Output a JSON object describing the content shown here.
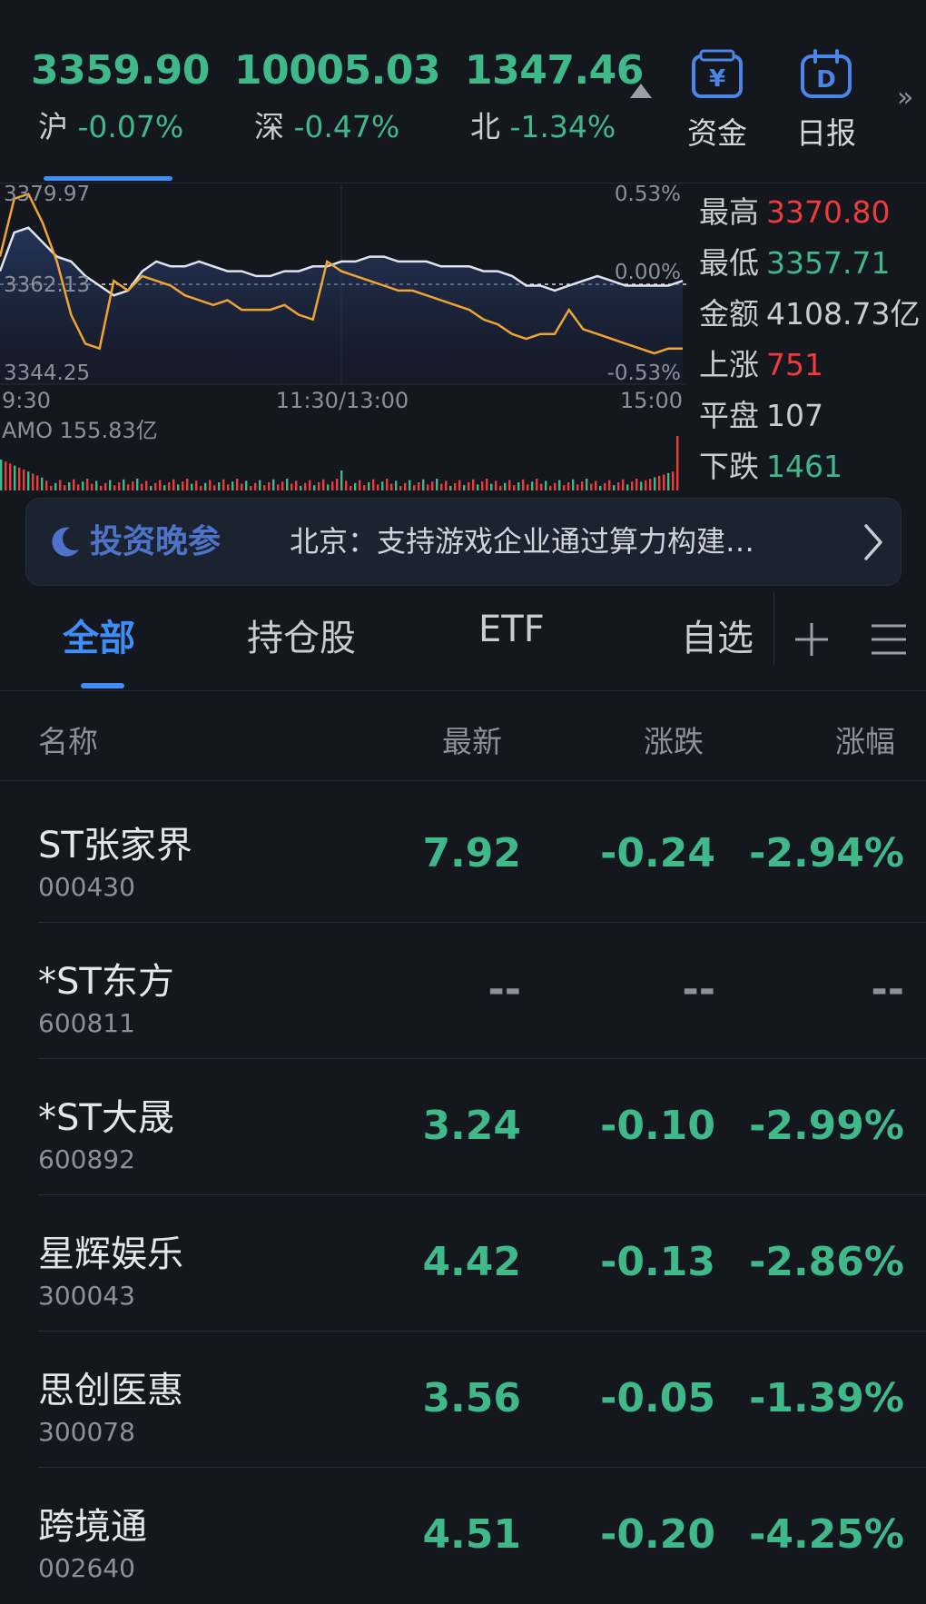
{
  "indices": [
    {
      "value": "3359.90",
      "name": "沪",
      "change": "-0.07%"
    },
    {
      "value": "10005.03",
      "name": "深",
      "change": "-0.47%"
    },
    {
      "value": "1347.46",
      "name": "北",
      "change": "-1.34%"
    }
  ],
  "shortcuts": [
    {
      "label": "资金",
      "icon": "yen-box-icon"
    },
    {
      "label": "日报",
      "icon": "calendar-d-icon"
    }
  ],
  "more_glyph": "»",
  "chart": {
    "y_high": "3379.97",
    "y_mid": "3362.13",
    "y_low": "3344.25",
    "pct_high": "0.53%",
    "pct_mid": "0.00%",
    "pct_low": "-0.53%",
    "time_start": "9:30",
    "time_mid": "11:30/13:00",
    "time_end": "15:00",
    "amo_label": "AMO 155.83亿",
    "colors": {
      "index_line": "#dfe4ee",
      "avg_line": "#f0a531",
      "up": "#ef3b3b",
      "down": "#3fb98a"
    }
  },
  "chart_data": {
    "type": "line",
    "ylim": [
      3344.25,
      3379.97
    ],
    "x_ticks": [
      "9:30",
      "11:30/13:00",
      "15:00"
    ],
    "series": [],
    "x": [
      0,
      1,
      2,
      3,
      4,
      5,
      6,
      7,
      8,
      9,
      10,
      11,
      12,
      13,
      14,
      15,
      16,
      17,
      18,
      19,
      20,
      21,
      22,
      23,
      24,
      25,
      26,
      27,
      28,
      29,
      30,
      31,
      32,
      33,
      34,
      35,
      36,
      37,
      38,
      39,
      40,
      41,
      42,
      43,
      44,
      45,
      46,
      47,
      48
    ],
    "line_a": [
      3362,
      3370,
      3371,
      3368,
      3365,
      3364,
      3361,
      3359,
      3357,
      3358,
      3362,
      3364,
      3363,
      3363,
      3364,
      3363,
      3362,
      3362,
      3361,
      3361,
      3362,
      3362,
      3363,
      3363,
      3364,
      3364,
      3365,
      3365,
      3364,
      3364,
      3364,
      3363,
      3363,
      3363,
      3362,
      3362,
      3361,
      3359,
      3359,
      3358,
      3359,
      3360,
      3361,
      3360,
      3359,
      3359,
      3359,
      3359,
      3360
    ],
    "line_b": [
      3365,
      3377,
      3378,
      3372,
      3364,
      3353,
      3347,
      3346,
      3360,
      3358,
      3361,
      3360,
      3359,
      3357,
      3356,
      3355,
      3356,
      3354,
      3354,
      3354,
      3355,
      3353,
      3352,
      3364,
      3362,
      3361,
      3360,
      3359,
      3358,
      3358,
      3357,
      3356,
      3355,
      3354,
      3352,
      3351,
      3349,
      3348,
      3349,
      3349,
      3354,
      3350,
      3349,
      3348,
      3347,
      3346,
      3345,
      3346,
      3346
    ]
  },
  "stats": [
    {
      "label": "最高",
      "value": "3370.80",
      "color": "red"
    },
    {
      "label": "最低",
      "value": "3357.71",
      "color": "green"
    },
    {
      "label": "金额",
      "value": "4108.73亿",
      "color": "plain"
    },
    {
      "label": "上涨",
      "value": "751",
      "color": "red"
    },
    {
      "label": "平盘",
      "value": "107",
      "color": "plain"
    },
    {
      "label": "下跌",
      "value": "1461",
      "color": "green"
    }
  ],
  "news": {
    "brand": "投资晚参",
    "headline": "北京：支持游戏企业通过算力构建…"
  },
  "tabs": [
    {
      "label": "全部",
      "active": true
    },
    {
      "label": "持仓股",
      "active": false
    },
    {
      "label": "ETF",
      "active": false
    },
    {
      "label": "自选",
      "active": false
    }
  ],
  "table": {
    "headers": [
      "名称",
      "最新",
      "涨跌",
      "涨幅"
    ],
    "rows": [
      {
        "name": "ST张家界",
        "code": "000430",
        "price": "7.92",
        "change": "-0.24",
        "pct": "-2.94%"
      },
      {
        "name": "*ST东方",
        "code": "600811",
        "price": "--",
        "change": "--",
        "pct": "--"
      },
      {
        "name": "*ST大晟",
        "code": "600892",
        "price": "3.24",
        "change": "-0.10",
        "pct": "-2.99%"
      },
      {
        "name": "星辉娱乐",
        "code": "300043",
        "price": "4.42",
        "change": "-0.13",
        "pct": "-2.86%"
      },
      {
        "name": "思创医惠",
        "code": "300078",
        "price": "3.56",
        "change": "-0.05",
        "pct": "-1.39%"
      },
      {
        "name": "跨境通",
        "code": "002640",
        "price": "4.51",
        "change": "-0.20",
        "pct": "-4.25%"
      }
    ]
  }
}
